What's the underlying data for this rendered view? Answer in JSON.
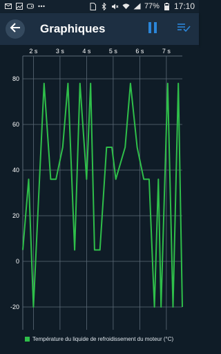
{
  "status_bar": {
    "battery_pct": "77%",
    "time": "17:10",
    "icons": [
      "mail-icon",
      "image-icon",
      "game-icon",
      "more-icon",
      "sim-icon",
      "bluetooth-icon",
      "mute-icon",
      "wifi-icon",
      "signal-icon",
      "battery-icon"
    ]
  },
  "app_bar": {
    "title": "Graphiques",
    "back_icon": "arrow-back-icon",
    "pause_icon": "pause-icon",
    "list_icon": "playlist-check-icon"
  },
  "colors": {
    "background": "#0f1c27",
    "app_bar": "#1d2f42",
    "accent": "#2b86d9",
    "series": "#2fbf4a",
    "grid": "#5c6b78"
  },
  "chart_data": {
    "type": "line",
    "xlabel": "",
    "ylabel": "",
    "x_ticks": [
      "2 s",
      "3 s",
      "4 s",
      "5 s",
      "6 s",
      "7 s"
    ],
    "y_ticks": [
      80,
      60,
      40,
      20,
      0,
      -20
    ],
    "ylim": [
      -20,
      80
    ],
    "xlim": [
      1.6,
      7.6
    ],
    "grid": true,
    "legend_position": "bottom-left",
    "series": [
      {
        "name": "Température du liquide de refroidissement du moteur (°C)",
        "x": [
          1.6,
          1.82,
          2.0,
          2.4,
          2.65,
          2.85,
          3.1,
          3.3,
          3.55,
          3.75,
          4.0,
          4.15,
          4.3,
          4.5,
          4.75,
          4.95,
          5.1,
          5.45,
          5.65,
          5.9,
          6.15,
          6.35,
          6.55,
          6.7,
          6.8,
          7.05,
          7.25,
          7.45,
          7.6
        ],
        "y": [
          5,
          36,
          -20,
          78,
          36,
          36,
          50,
          78,
          5,
          78,
          36,
          78,
          5,
          5,
          50,
          50,
          36,
          50,
          78,
          50,
          36,
          36,
          -20,
          36,
          -20,
          78,
          -20,
          78,
          -20
        ]
      }
    ]
  }
}
